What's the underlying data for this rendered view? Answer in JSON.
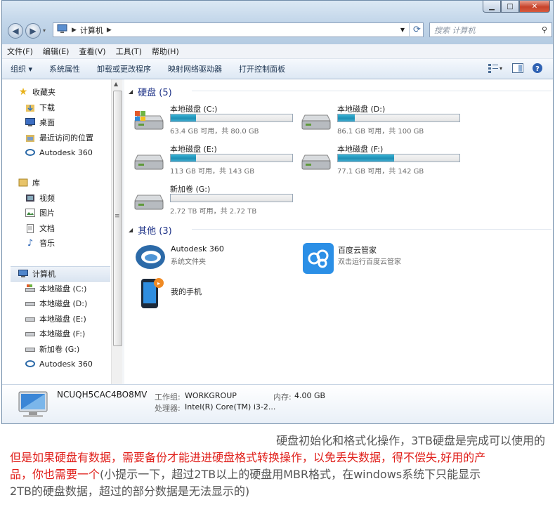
{
  "window": {
    "min": "▁",
    "max": "□",
    "close": "✕"
  },
  "address": {
    "path": [
      "计算机"
    ],
    "search_placeholder": "搜索 计算机"
  },
  "menu": [
    "文件(F)",
    "编辑(E)",
    "查看(V)",
    "工具(T)",
    "帮助(H)"
  ],
  "toolbar": {
    "organize": "组织 ▾",
    "items": [
      "系统属性",
      "卸载或更改程序",
      "映射网络驱动器",
      "打开控制面板"
    ]
  },
  "nav": {
    "favorites": {
      "label": "收藏夹",
      "items": [
        "下载",
        "桌面",
        "最近访问的位置",
        "Autodesk 360"
      ]
    },
    "library": {
      "label": "库",
      "items": [
        "视频",
        "图片",
        "文档",
        "音乐"
      ]
    },
    "computer": {
      "label": "计算机",
      "items": [
        "本地磁盘 (C:)",
        "本地磁盘 (D:)",
        "本地磁盘 (E:)",
        "本地磁盘 (F:)",
        "新加卷 (G:)",
        "Autodesk 360"
      ]
    }
  },
  "groups": {
    "drives": "硬盘 (5)",
    "other": "其他 (3)"
  },
  "drives": [
    {
      "name": "本地磁盘 (C:)",
      "info": "63.4 GB 可用，共 80.0 GB",
      "used": 0.21
    },
    {
      "name": "本地磁盘 (D:)",
      "info": "86.1 GB 可用，共 100 GB",
      "used": 0.14
    },
    {
      "name": "本地磁盘 (E:)",
      "info": "113 GB 可用，共 143 GB",
      "used": 0.21
    },
    {
      "name": "本地磁盘 (F:)",
      "info": "77.1 GB 可用，共 142 GB",
      "used": 0.46
    },
    {
      "name": "新加卷 (G:)",
      "info": "2.72 TB 可用，共 2.72 TB",
      "used": 0.0
    }
  ],
  "others": [
    {
      "name": "Autodesk 360",
      "sub": "系统文件夹"
    },
    {
      "name": "百度云管家",
      "sub": "双击运行百度云管家"
    },
    {
      "name": "我的手机",
      "sub": ""
    }
  ],
  "details": {
    "computer_name": "NCUQH5CAC4BO8MV",
    "workgroup_label": "工作组:",
    "workgroup": "WORKGROUP",
    "memory_label": "内存:",
    "memory": "4.00 GB",
    "cpu_label": "处理器:",
    "cpu": "Intel(R) Core(TM) i3-2..."
  },
  "caption": {
    "l1": "硬盘初始化和格式化操作，3TB硬盘是完成可以使用的",
    "l2": "但是如果硬盘有数据，需要备份才能进进硬盘格式转换操作，以免丢失数据，得不偿失,好用的产",
    "l3_red": "品，你也需要一个",
    "l3_gray": "(小提示一下，超过2TB以上的硬盘用MBR格式，在windows系统下只能显示",
    "l4": "2TB的硬盘数据，超过的部分数据是无法显示的)"
  },
  "colors": {
    "accent": "#1e3287",
    "bar": "#1e8fb4",
    "caption_red": "#e01f1a"
  }
}
